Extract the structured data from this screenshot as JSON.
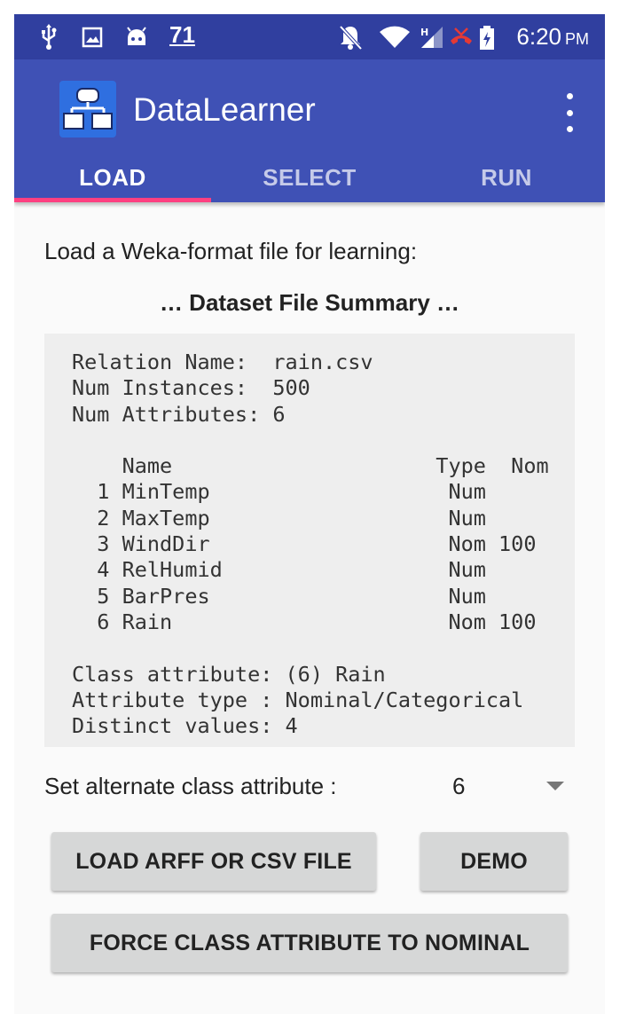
{
  "status_bar": {
    "icons": [
      "usb-icon",
      "image-icon",
      "android-icon",
      "bell-off-icon",
      "wifi-icon",
      "signal-icon",
      "missed-call-icon",
      "battery-charging-icon"
    ],
    "notification_count": "71",
    "time": "6:20",
    "ampm": "PM",
    "background": "#303f9f"
  },
  "app_bar": {
    "title": "DataLearner",
    "logo_icon": "hierarchy-icon",
    "menu_icon": "overflow-menu-icon",
    "background": "#3f51b5"
  },
  "tabs": [
    {
      "label": "LOAD",
      "active": true
    },
    {
      "label": "SELECT",
      "active": false
    },
    {
      "label": "RUN",
      "active": false
    }
  ],
  "tab_indicator_color": "#ff4081",
  "load": {
    "instruction": "Load a Weka-format file for learning:",
    "summary_title": "… Dataset File Summary …",
    "summary_lines": [
      "Relation Name:  rain.csv",
      "Num Instances:  500",
      "Num Attributes: 6",
      "",
      "    Name                     Type  Nom",
      "  1 MinTemp                   Num",
      "  2 MaxTemp                   Num",
      "  3 WindDir                   Nom 100",
      "  4 RelHumid                  Num",
      "  5 BarPres                   Num",
      "  6 Rain                      Nom 100",
      "",
      "Class attribute: (6) Rain",
      "Attribute type : Nominal/Categorical",
      "Distinct values: 4"
    ],
    "alt_class_label": "Set alternate class attribute :",
    "alt_class_value": "6",
    "load_button": "LOAD ARFF OR CSV FILE",
    "demo_button": "DEMO",
    "force_button": "FORCE CLASS ATTRIBUTE TO NOMINAL"
  }
}
